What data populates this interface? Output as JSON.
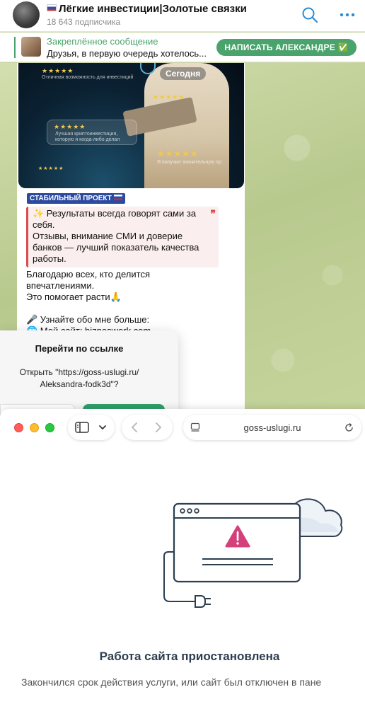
{
  "telegram": {
    "channel_title": "Лёгкие инвестиции|Золотые связки",
    "subscribers": "18 643 подписчика",
    "pinned_title": "Закреплённое сообщение",
    "pinned_text": "Друзья, в первую очередь хотелось...",
    "write_button": "НАПИСАТЬ АЛЕКСАНДРЕ ✅",
    "photo": {
      "today_label": "Сегодня",
      "stars": "★★★★★",
      "card_best": "Лучшая криптоинвестиция, которую я когда-либо делал",
      "card_opportunity": "Отличная возможность для инвестиций",
      "card_received": "Я получил значительную пр"
    },
    "project_tag": "СТАБИЛЬНЫЙ ПРОЕКТ",
    "quote_text": "✨ Результаты всегда говорят сами за себя.\nОтзывы, внимание СМИ и доверие банков — лучший показатель качества работы.",
    "quote_mark": "❞",
    "body_text": "Благодарю всех, кто делится впечатлениями.\nЭто помогает расти🙏\n\n🎤 Узнайте обо мне больше:\n🌐 Мой сайт: bizneswork.com"
  },
  "dialog": {
    "title": "Перейти по ссылке",
    "text": "Открыть \"https://goss-uslugi.ru/ Aleksandra-fodk3d\"?"
  },
  "safari": {
    "url": "goss-uslugi.ru",
    "error_title": "Работа сайта приостановлена",
    "error_subtitle": "Закончился срок действия услуги, или сайт был отключен в пане"
  },
  "colors": {
    "telegram_green": "#4aa36c",
    "warning_pink": "#d4407a",
    "illustration_stroke": "#2c3e50"
  }
}
